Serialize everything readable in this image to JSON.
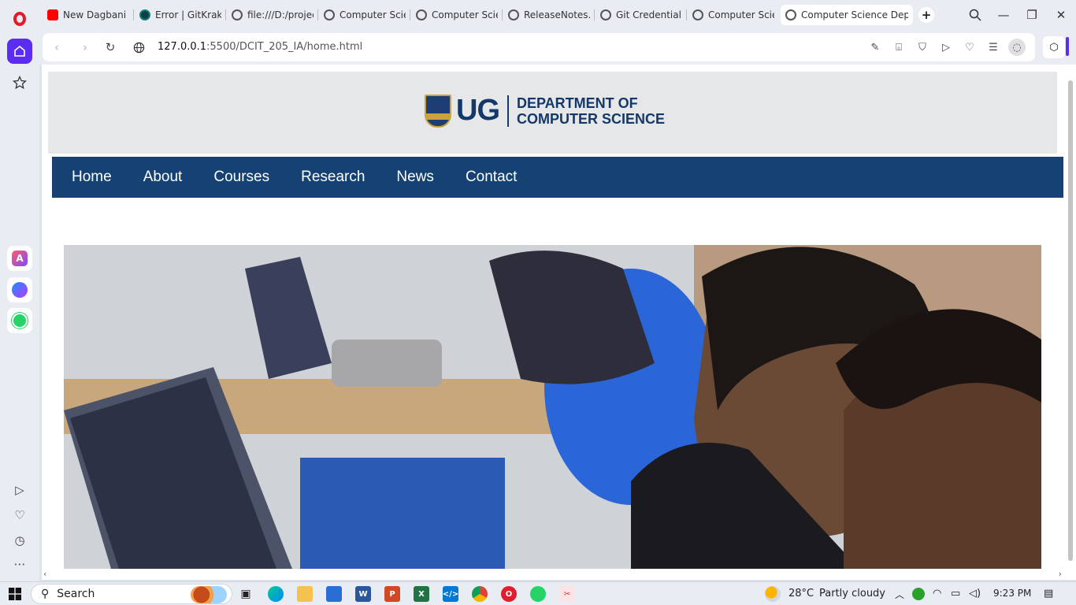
{
  "browser": {
    "tabs": [
      {
        "label": "New Dagbani m",
        "icon": "youtube-icon"
      },
      {
        "label": "Error | GitKraken",
        "icon": "gitkraken-icon"
      },
      {
        "label": "file:///D:/project",
        "icon": "globe-icon"
      },
      {
        "label": "Computer Scienc",
        "icon": "globe-icon"
      },
      {
        "label": "Computer Scienc",
        "icon": "globe-icon"
      },
      {
        "label": "ReleaseNotes.htr",
        "icon": "globe-icon"
      },
      {
        "label": "Git Credential M",
        "icon": "globe-icon"
      },
      {
        "label": "Computer Scienc",
        "icon": "globe-icon"
      },
      {
        "label": "Computer Science Depart",
        "icon": "globe-icon",
        "active": true
      }
    ],
    "url_host": "127.0.0.1",
    "url_rest": ":5500/DCIT_205_IA/home.html"
  },
  "page": {
    "logo_ug": "UG",
    "dept_line1": "DEPARTMENT OF",
    "dept_line2": "COMPUTER SCIENCE",
    "nav": [
      "Home",
      "About",
      "Courses",
      "Research",
      "News",
      "Contact"
    ]
  },
  "taskbar": {
    "search_label": "Search",
    "weather_temp": "28°C",
    "weather_desc": "Partly cloudy",
    "time": "9:23 PM"
  },
  "colors": {
    "nav_bg": "#154273",
    "brand_blue": "#14386a",
    "opera_accent": "#5a2df0"
  }
}
